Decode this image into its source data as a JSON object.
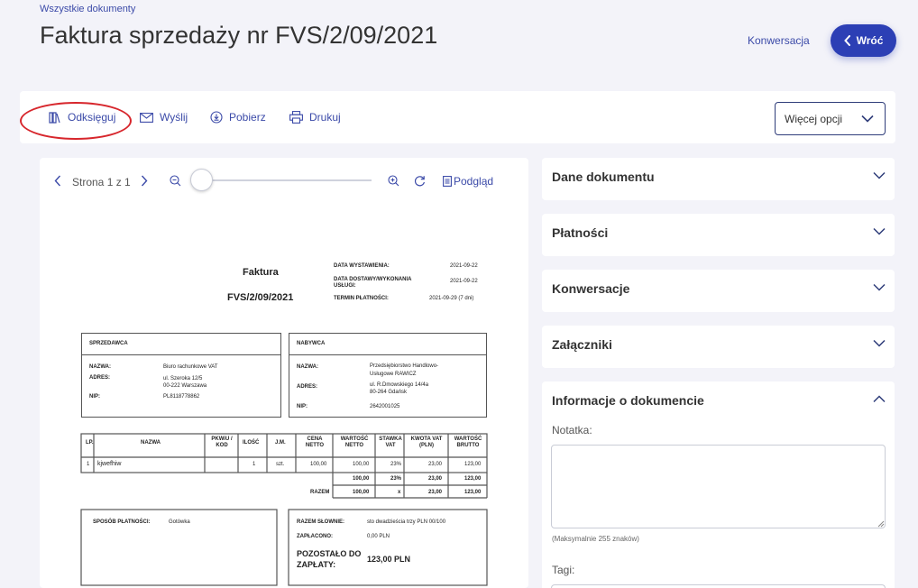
{
  "header": {
    "breadcrumb": "Wszystkie dokumenty",
    "title": "Faktura sprzedaży nr FVS/2/09/2021",
    "conversation_link": "Konwersacja",
    "back_button": "Wróć"
  },
  "toolbar": {
    "book_label": "Odksięguj",
    "send_label": "Wyślij",
    "download_label": "Pobierz",
    "print_label": "Drukuj",
    "more_options": "Więcej opcji"
  },
  "viewer": {
    "page_label": "Strona 1 z 1",
    "preview_label": "Podgląd",
    "zoom_level": 0
  },
  "invoice": {
    "doc_type": "Faktura",
    "number": "FVS/2/09/2021",
    "meta": [
      {
        "label": "DATA WYSTAWIENIA:",
        "value": "2021-09-22"
      },
      {
        "label": "DATA DOSTAWY/WYKONANIA USŁUGI:",
        "value": "2021-09-22"
      },
      {
        "label": "TERMIN PŁATNOŚCI:",
        "value": "2021-09-29 (7 dni)"
      }
    ],
    "seller": {
      "heading": "SPRZEDAWCA",
      "name_label": "NAZWA:",
      "name": "Biuro rachunkowe VAT",
      "address_label": "ADRES:",
      "address1": "ul. Szeroka 12/5",
      "address2": "00-222 Warszawa",
      "nip_label": "NIP:",
      "nip": "PL8118778862"
    },
    "buyer": {
      "heading": "NABYWCA",
      "name_label": "NAZWA:",
      "name1": "Przedsiębiorstwo Handlowo-",
      "name2": "Usługowe RAWICZ",
      "address_label": "ADRES:",
      "address1": "ul. R.Dmowskiego 14/4a",
      "address2": "80-264 Gdańsk",
      "nip_label": "NIP:",
      "nip": "2642001025"
    },
    "table": {
      "headers": [
        "LP.",
        "NAZWA",
        "PKWiU / KOD",
        "ILOŚĆ",
        "J.M.",
        "CENA NETTO",
        "WARTOŚĆ NETTO",
        "STAWKA VAT",
        "KWOTA VAT (PLN)",
        "WARTOŚĆ BRUTTO"
      ],
      "rows": [
        [
          "1",
          "kjwefhiw",
          "",
          "1",
          "szt.",
          "100,00",
          "100,00",
          "23%",
          "23,00",
          "123,00"
        ]
      ],
      "subtotal": [
        "100,00",
        "23%",
        "23,00",
        "123,00"
      ],
      "total_label": "RAZEM",
      "total": [
        "100,00",
        "x",
        "23,00",
        "123,00"
      ]
    },
    "payment": {
      "label": "SPOSÓB PŁATNOŚCI:",
      "value": "Gotówka"
    },
    "summary": {
      "words_label": "RAZEM SŁOWNIE:",
      "words": "sto dwadzieścia trzy PLN 00/100",
      "paid_label": "ZAPŁACONO:",
      "paid": "0,00 PLN",
      "due_label1": "POZOSTAŁO DO",
      "due_label2": "ZAPŁATY:",
      "due": "123,00 PLN"
    }
  },
  "panels": {
    "doc_data": "Dane dokumentu",
    "payments": "Płatności",
    "conversations": "Konwersacje",
    "attachments": "Załączniki",
    "info": "Informacje o dokumencie",
    "note_label": "Notatka:",
    "note_value": "",
    "note_hint": "(Maksymalnie 255 znaków)",
    "tags_label": "Tagi:"
  },
  "colors": {
    "accent": "#2c3fb5",
    "link": "#3b4aa8",
    "highlight": "#d7262c"
  }
}
